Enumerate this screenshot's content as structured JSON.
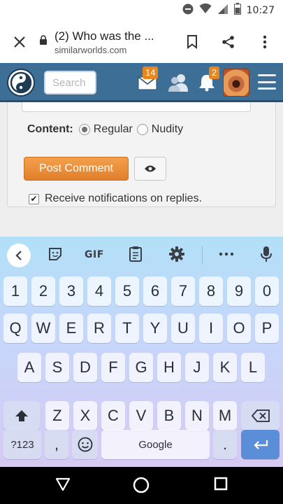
{
  "status_bar": {
    "time": "10:27",
    "icons": [
      "do-not-disturb-icon",
      "wifi-icon",
      "signal-icon",
      "battery-icon"
    ]
  },
  "browser": {
    "page_title": "(2) Who was the ...",
    "url": "similarworlds.com",
    "icons": [
      "close-icon",
      "lock-icon",
      "bookmark-icon",
      "share-icon",
      "more-vert-icon"
    ]
  },
  "site_header": {
    "search_placeholder": "Search",
    "messages_badge": "14",
    "notifications_badge": "2",
    "colors": {
      "header_bg": "#3c6e96",
      "badge": "#e8861f"
    }
  },
  "comment_form": {
    "content_label": "Content:",
    "options": [
      "Regular",
      "Nudity"
    ],
    "selected_option": "Regular",
    "post_button": "Post Comment",
    "notify_label": "Receive notifications on replies.",
    "notify_checked": true,
    "colors": {
      "post_button": "#e98f35"
    }
  },
  "keyboard": {
    "toolbar": {
      "gif_label": "GIF"
    },
    "row_numbers": [
      "1",
      "2",
      "3",
      "4",
      "5",
      "6",
      "7",
      "8",
      "9",
      "0"
    ],
    "row1": [
      "Q",
      "W",
      "E",
      "R",
      "T",
      "Y",
      "U",
      "I",
      "O",
      "P"
    ],
    "row2": [
      "A",
      "S",
      "D",
      "F",
      "G",
      "H",
      "J",
      "K",
      "L"
    ],
    "row3": [
      "Z",
      "X",
      "C",
      "V",
      "B",
      "N",
      "M"
    ],
    "symbols_key": "?123",
    "comma_key": ",",
    "space_label": "Google",
    "period_key": ".",
    "colors": {
      "enter": "#5a8ed8"
    }
  }
}
